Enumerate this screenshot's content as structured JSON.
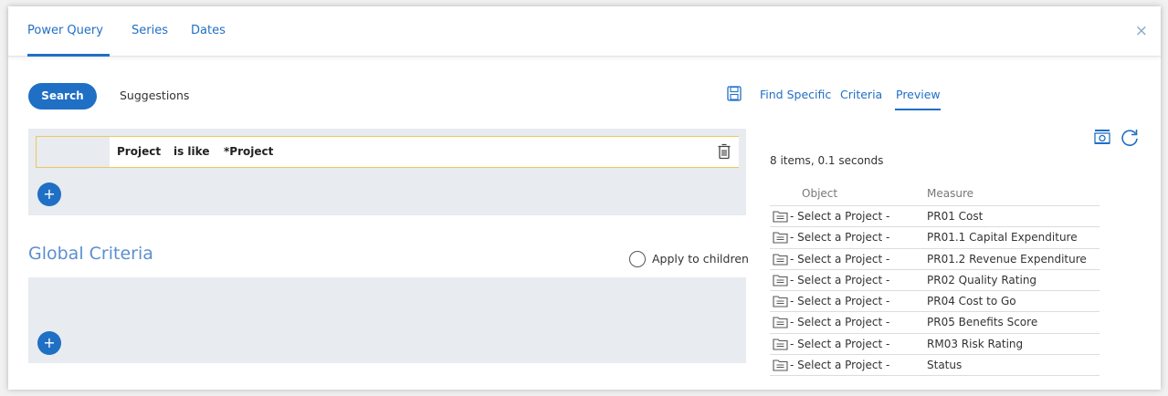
{
  "tabs": [
    "Power Query",
    "Series",
    "Dates"
  ],
  "search_label": "Search",
  "suggestions_label": "Suggestions",
  "right_tabs": [
    "Find Specific",
    "Criteria",
    "Preview"
  ],
  "criteria": {
    "field": "Project",
    "operator": "is like",
    "value": "*Project"
  },
  "plus_label": "+",
  "global_criteria_title": "Global Criteria",
  "apply_to_children_label": "Apply to children",
  "close_glyph": "×",
  "preview": {
    "items_count": "8 items, 0.1 seconds",
    "columns": [
      "Object",
      "Measure"
    ],
    "rows": [
      {
        "object": "- Select a Project -",
        "measure": "PR01 Cost"
      },
      {
        "object": "- Select a Project -",
        "measure": "PR01.1 Capital Expenditure"
      },
      {
        "object": "- Select a Project -",
        "measure": "PR01.2 Revenue Expenditure"
      },
      {
        "object": "- Select a Project -",
        "measure": "PR02 Quality Rating"
      },
      {
        "object": "- Select a Project -",
        "measure": "PR04 Cost to Go"
      },
      {
        "object": "- Select a Project -",
        "measure": "PR05 Benefits Score"
      },
      {
        "object": "- Select a Project -",
        "measure": "RM03 Risk Rating"
      },
      {
        "object": "- Select a Project -",
        "measure": "Status"
      }
    ]
  },
  "colors": {
    "accent": "#1f6fc5",
    "panel": "#e8ebef",
    "highlight_border": "#f0c75a",
    "title": "#5b8fcf"
  }
}
